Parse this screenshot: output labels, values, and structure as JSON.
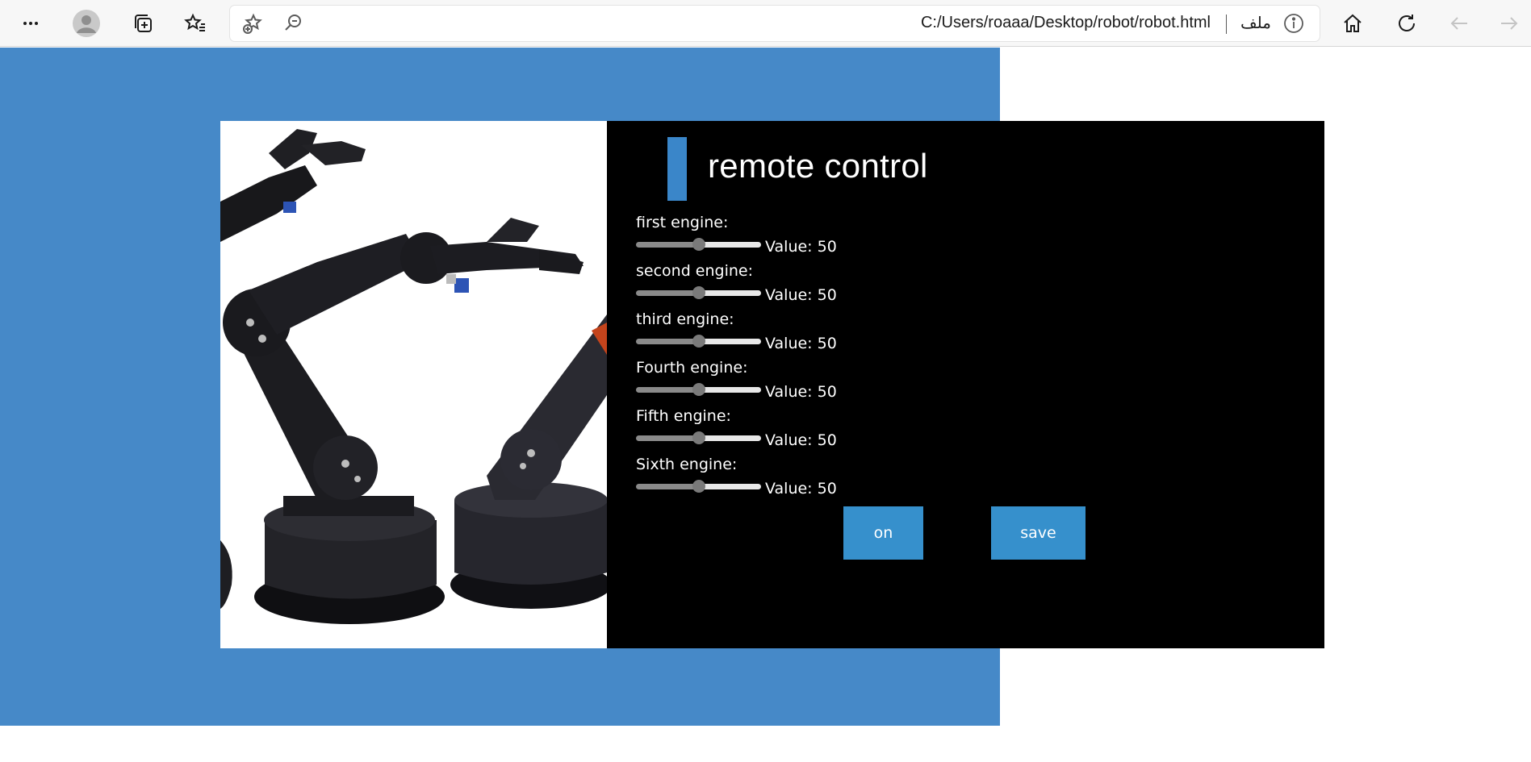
{
  "browser": {
    "url": "C:/Users/roaaa/Desktop/robot/robot.html",
    "file_label": "ملف",
    "icons": {
      "more": "more-icon",
      "profile": "profile-avatar-icon",
      "collections": "collections-icon",
      "favorites": "favorites-icon",
      "add_favorite": "add-favorite-icon",
      "zoom": "zoom-icon",
      "info": "info-icon",
      "home": "home-icon",
      "refresh": "refresh-icon",
      "back": "back-arrow-icon",
      "forward": "forward-arrow-icon"
    }
  },
  "colors": {
    "page_background": "#4689c8",
    "panel_background": "#000000",
    "accent": "#3a86c9",
    "button": "#3690cc"
  },
  "panel": {
    "title": "remote control",
    "engines": [
      {
        "label": "first engine:",
        "value_text": "Value: 50",
        "value": 50
      },
      {
        "label": "second engine:",
        "value_text": "Value: 50",
        "value": 50
      },
      {
        "label": "third engine:",
        "value_text": "Value: 50",
        "value": 50
      },
      {
        "label": "Fourth engine:",
        "value_text": "Value: 50",
        "value": 50
      },
      {
        "label": "Fifth engine:",
        "value_text": "Value: 50",
        "value": 50
      },
      {
        "label": "Sixth engine:",
        "value_text": "Value: 50",
        "value": 50
      }
    ],
    "buttons": {
      "on": "on",
      "save": "save"
    }
  }
}
